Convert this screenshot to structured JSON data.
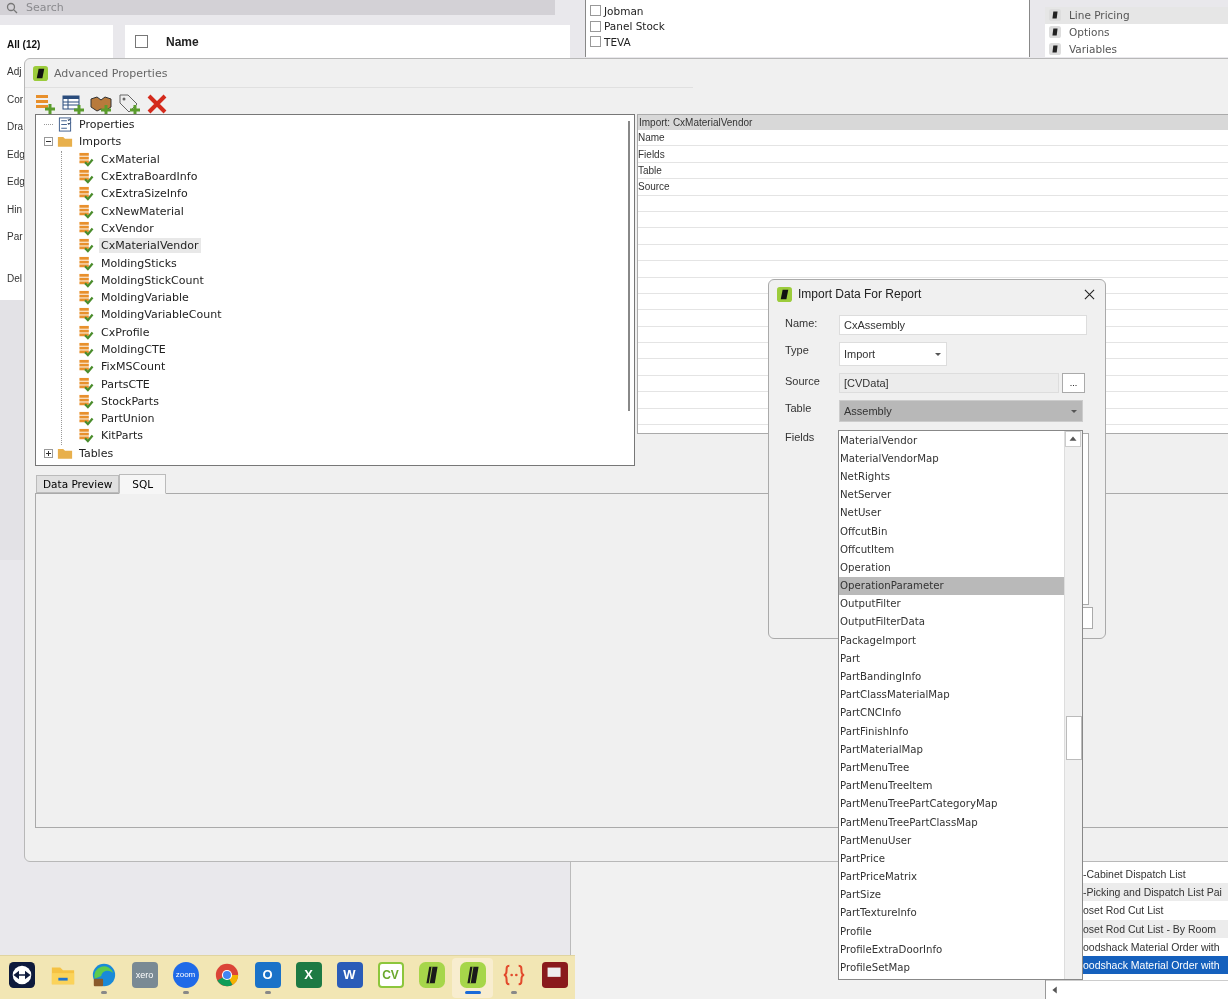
{
  "background_app": {
    "search": {
      "placeholder": "Search"
    },
    "filters": [
      {
        "label": "All (12)",
        "selected": true
      },
      {
        "label": "Adj",
        "selected": false
      },
      {
        "label": "Cor",
        "selected": false
      },
      {
        "label": "Dra",
        "selected": false
      },
      {
        "label": "Edg",
        "selected": false
      },
      {
        "label": "Edg",
        "selected": false
      },
      {
        "label": "Hin",
        "selected": false
      },
      {
        "label": "Par",
        "selected": false
      },
      {
        "label": "Del",
        "selected": false
      }
    ],
    "table": {
      "select_all_checked": false,
      "columns": [
        "Name"
      ]
    }
  },
  "vendor_list": {
    "items": [
      {
        "label": "Jobman",
        "checked": false
      },
      {
        "label": "Panel Stock",
        "checked": false
      },
      {
        "label": "TEVA",
        "checked": false
      }
    ]
  },
  "nav_list": {
    "items": [
      {
        "label": "Line Pricing",
        "selected": true
      },
      {
        "label": "Options",
        "selected": false
      },
      {
        "label": "Variables",
        "selected": false
      }
    ]
  },
  "advanced_properties": {
    "title": "Advanced Properties",
    "toolbar": [
      {
        "kind": "add-import"
      },
      {
        "kind": "add-table"
      },
      {
        "kind": "relationship"
      },
      {
        "kind": "tag"
      },
      {
        "kind": "delete"
      }
    ],
    "tree": [
      {
        "label": "Properties",
        "kind": "properties",
        "selected": false
      },
      {
        "label": "Imports",
        "kind": "folder",
        "expanded": true,
        "selected": false,
        "children": [
          {
            "label": "CxMaterial",
            "selected": false
          },
          {
            "label": "CxExtraBoardInfo",
            "selected": false
          },
          {
            "label": "CxExtraSizeInfo",
            "selected": false
          },
          {
            "label": "CxNewMaterial",
            "selected": false
          },
          {
            "label": "CxVendor",
            "selected": false
          },
          {
            "label": "CxMaterialVendor",
            "selected": true
          },
          {
            "label": "MoldingSticks",
            "selected": false
          },
          {
            "label": "MoldingStickCount",
            "selected": false
          },
          {
            "label": "MoldingVariable",
            "selected": false
          },
          {
            "label": "MoldingVariableCount",
            "selected": false
          },
          {
            "label": "CxProfile",
            "selected": false
          },
          {
            "label": "MoldingCTE",
            "selected": false
          },
          {
            "label": "FixMSCount",
            "selected": false
          },
          {
            "label": "PartsCTE",
            "selected": false
          },
          {
            "label": "StockParts",
            "selected": false
          },
          {
            "label": "PartUnion",
            "selected": false
          },
          {
            "label": "KitParts",
            "selected": false
          }
        ]
      },
      {
        "label": "Tables",
        "kind": "folder",
        "expanded": false,
        "selected": false
      }
    ],
    "property_grid": {
      "header": "Import: CxMaterialVendor",
      "rows": [
        "Name",
        "Fields",
        "Table",
        "Source"
      ]
    },
    "tabs": [
      {
        "label": "Data Preview",
        "selected": false
      },
      {
        "label": "SQL",
        "selected": true
      }
    ]
  },
  "import_dialog": {
    "title": "Import Data For Report",
    "name": {
      "label": "Name:",
      "value": "CxAssembly"
    },
    "type": {
      "label": "Type",
      "value": "Import"
    },
    "source": {
      "label": "Source",
      "value": "[CVData]",
      "button": "..."
    },
    "table": {
      "label": "Table",
      "value": "Assembly"
    },
    "fields": {
      "label": "Fields"
    },
    "table_options": [
      {
        "label": "MaterialVendor",
        "selected": false
      },
      {
        "label": "MaterialVendorMap",
        "selected": false
      },
      {
        "label": "NetRights",
        "selected": false
      },
      {
        "label": "NetServer",
        "selected": false
      },
      {
        "label": "NetUser",
        "selected": false
      },
      {
        "label": "OffcutBin",
        "selected": false
      },
      {
        "label": "OffcutItem",
        "selected": false
      },
      {
        "label": "Operation",
        "selected": false
      },
      {
        "label": "OperationParameter",
        "selected": true
      },
      {
        "label": "OutputFilter",
        "selected": false
      },
      {
        "label": "OutputFilterData",
        "selected": false
      },
      {
        "label": "PackageImport",
        "selected": false
      },
      {
        "label": "Part",
        "selected": false
      },
      {
        "label": "PartBandingInfo",
        "selected": false
      },
      {
        "label": "PartClassMaterialMap",
        "selected": false
      },
      {
        "label": "PartCNCInfo",
        "selected": false
      },
      {
        "label": "PartFinishInfo",
        "selected": false
      },
      {
        "label": "PartMaterialMap",
        "selected": false
      },
      {
        "label": "PartMenuTree",
        "selected": false
      },
      {
        "label": "PartMenuTreeItem",
        "selected": false
      },
      {
        "label": "PartMenuTreePartCategoryMap",
        "selected": false
      },
      {
        "label": "PartMenuTreePartClassMap",
        "selected": false
      },
      {
        "label": "PartMenuUser",
        "selected": false
      },
      {
        "label": "PartPrice",
        "selected": false
      },
      {
        "label": "PartPriceMatrix",
        "selected": false
      },
      {
        "label": "PartSize",
        "selected": false
      },
      {
        "label": "PartTextureInfo",
        "selected": false
      },
      {
        "label": "Profile",
        "selected": false
      },
      {
        "label": "ProfileExtraDoorInfo",
        "selected": false
      },
      {
        "label": "ProfileSetMap",
        "selected": false
      }
    ]
  },
  "report_list": {
    "items": [
      {
        "label": "-Cabinet Dispatch List",
        "selected": false
      },
      {
        "label": "-Picking and Dispatch List Pai",
        "selected": false
      },
      {
        "label": "oset Rod Cut List",
        "selected": false
      },
      {
        "label": "oset Rod Cut List - By Room",
        "selected": false
      },
      {
        "label": "oodshack Material Order with",
        "selected": false
      },
      {
        "label": "oodshack Material Order with",
        "selected": true
      }
    ]
  },
  "taskbar": {
    "apps": [
      {
        "kind": "remote",
        "running": false,
        "active": false
      },
      {
        "kind": "folder",
        "running": false,
        "active": false
      },
      {
        "kind": "browser",
        "running": true,
        "active": false
      },
      {
        "kind": "xero",
        "label": "xero",
        "running": false,
        "active": false
      },
      {
        "kind": "video",
        "label": "zoom",
        "running": true,
        "active": false
      },
      {
        "kind": "chrome",
        "running": false,
        "active": false
      },
      {
        "kind": "mail",
        "label": "O",
        "running": true,
        "active": false
      },
      {
        "kind": "sheet",
        "label": "X",
        "running": false,
        "active": false
      },
      {
        "kind": "doc",
        "label": "W",
        "running": false,
        "active": false
      },
      {
        "kind": "cv",
        "label": "CV",
        "running": false,
        "active": false
      },
      {
        "kind": "app",
        "running": false,
        "active": false
      },
      {
        "kind": "app",
        "running": true,
        "active": true
      },
      {
        "kind": "braces",
        "running": true,
        "active": false
      },
      {
        "kind": "dark",
        "running": false,
        "active": false
      }
    ]
  }
}
